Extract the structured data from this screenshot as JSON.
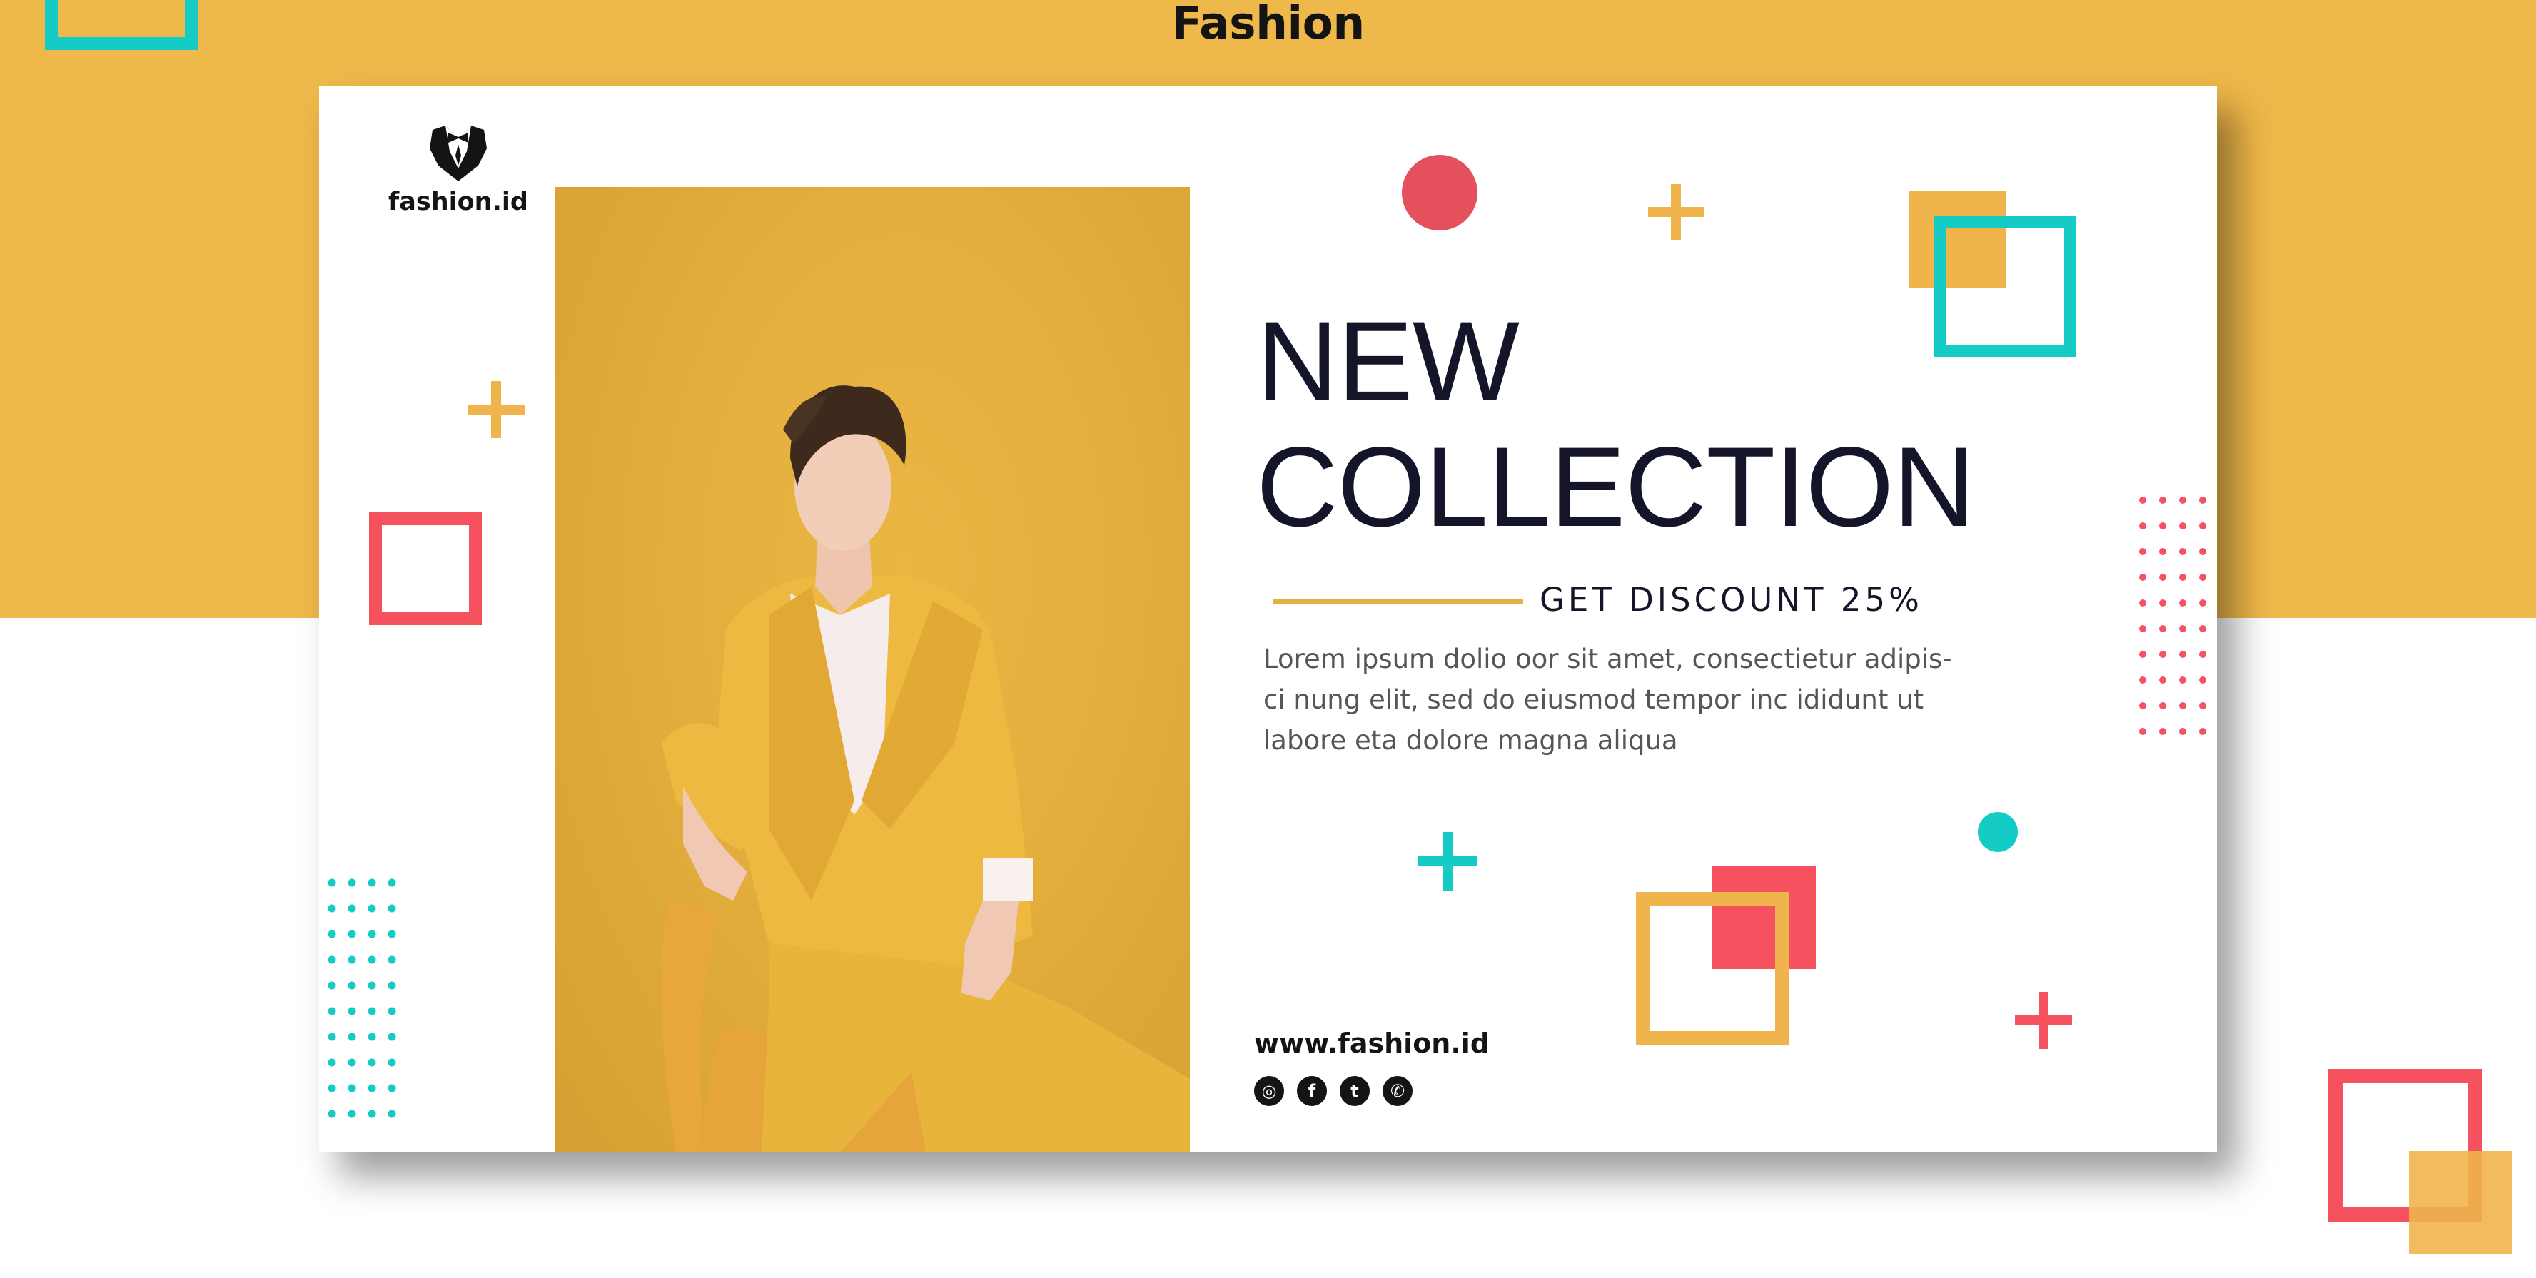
{
  "page": {
    "title": "Fashion"
  },
  "brand": {
    "logo_text": "fashion.id",
    "website": "www.fashion.id"
  },
  "banner": {
    "headline_line1": "NEW",
    "headline_line2": "COLLECTION",
    "discount": "GET DISCOUNT 25%",
    "body_line1": "Lorem ipsum dolio oor sit amet, consectietur adipis-",
    "body_line2": "ci nung elit, sed do eiusmod tempor inc ididunt ut",
    "body_line3": "labore eta dolore magna aliqua"
  },
  "socials": [
    {
      "icon": "instagram-icon",
      "glyph": "◎"
    },
    {
      "icon": "facebook-icon",
      "glyph": "f"
    },
    {
      "icon": "twitter-icon",
      "glyph": "t"
    },
    {
      "icon": "whatsapp-icon",
      "glyph": "✆"
    }
  ],
  "colors": {
    "background_top": "#EFB84A",
    "yellow": "#F0B44C",
    "teal": "#14CBC6",
    "red": "#F5515F",
    "dark": "#15152A"
  }
}
